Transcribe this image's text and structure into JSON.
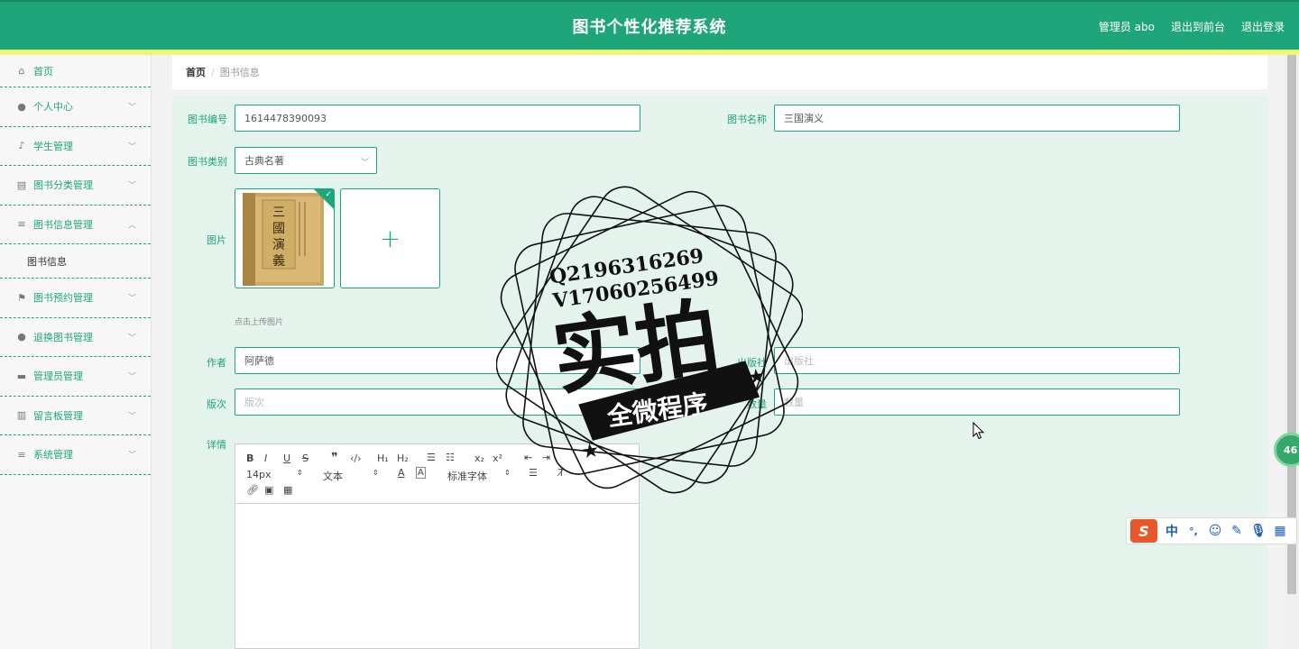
{
  "header": {
    "title": "图书个性化推荐系统",
    "admin_label": "管理员 abo",
    "back_front": "退出到前台",
    "logout": "退出登录"
  },
  "sidebar": {
    "items": [
      {
        "label": "首页",
        "icon": "home-icon"
      },
      {
        "label": "个人中心",
        "icon": "user-icon"
      },
      {
        "label": "学生管理",
        "icon": "mic-icon"
      },
      {
        "label": "图书分类管理",
        "icon": "chart-icon"
      },
      {
        "label": "图书信息管理",
        "icon": "list-icon",
        "expanded": true
      },
      {
        "label": "图书预约管理",
        "icon": "flag-icon"
      },
      {
        "label": "退换图书管理",
        "icon": "user-icon"
      },
      {
        "label": "管理员管理",
        "icon": "monitor-icon"
      },
      {
        "label": "留言板管理",
        "icon": "bar-chart-icon"
      },
      {
        "label": "系统管理",
        "icon": "list-icon"
      }
    ],
    "subitem": "图书信息"
  },
  "breadcrumb": {
    "home": "首页",
    "sep": "/",
    "current": "图书信息"
  },
  "form": {
    "book_no_label": "图书编号",
    "book_no_value": "1614478390093",
    "book_name_label": "图书名称",
    "book_name_value": "三国演义",
    "category_label": "图书类别",
    "category_value": "古典名著",
    "image_label": "图片",
    "upload_hint": "点击上传图片",
    "author_label": "作者",
    "author_value": "阿萨德",
    "publisher_label": "出版社",
    "publisher_placeholder": "出版社",
    "edition_label": "版次",
    "edition_placeholder": "版次",
    "quantity_label": "数量",
    "quantity_placeholder": "数量",
    "detail_label": "详情"
  },
  "editor": {
    "font_size": "14px",
    "block_type": "文本",
    "font_family": "标准字体"
  },
  "stamp": {
    "line1": "Q2196316269",
    "line2": "V17060256499",
    "big": "实拍",
    "banner": "全微程序"
  },
  "badge": "46",
  "ime": {
    "lang": "中",
    "punct": "°,"
  },
  "colors": {
    "primary": "#1ea67a",
    "accent_bar": "#eef77a",
    "form_bg": "#e4f3ec"
  }
}
